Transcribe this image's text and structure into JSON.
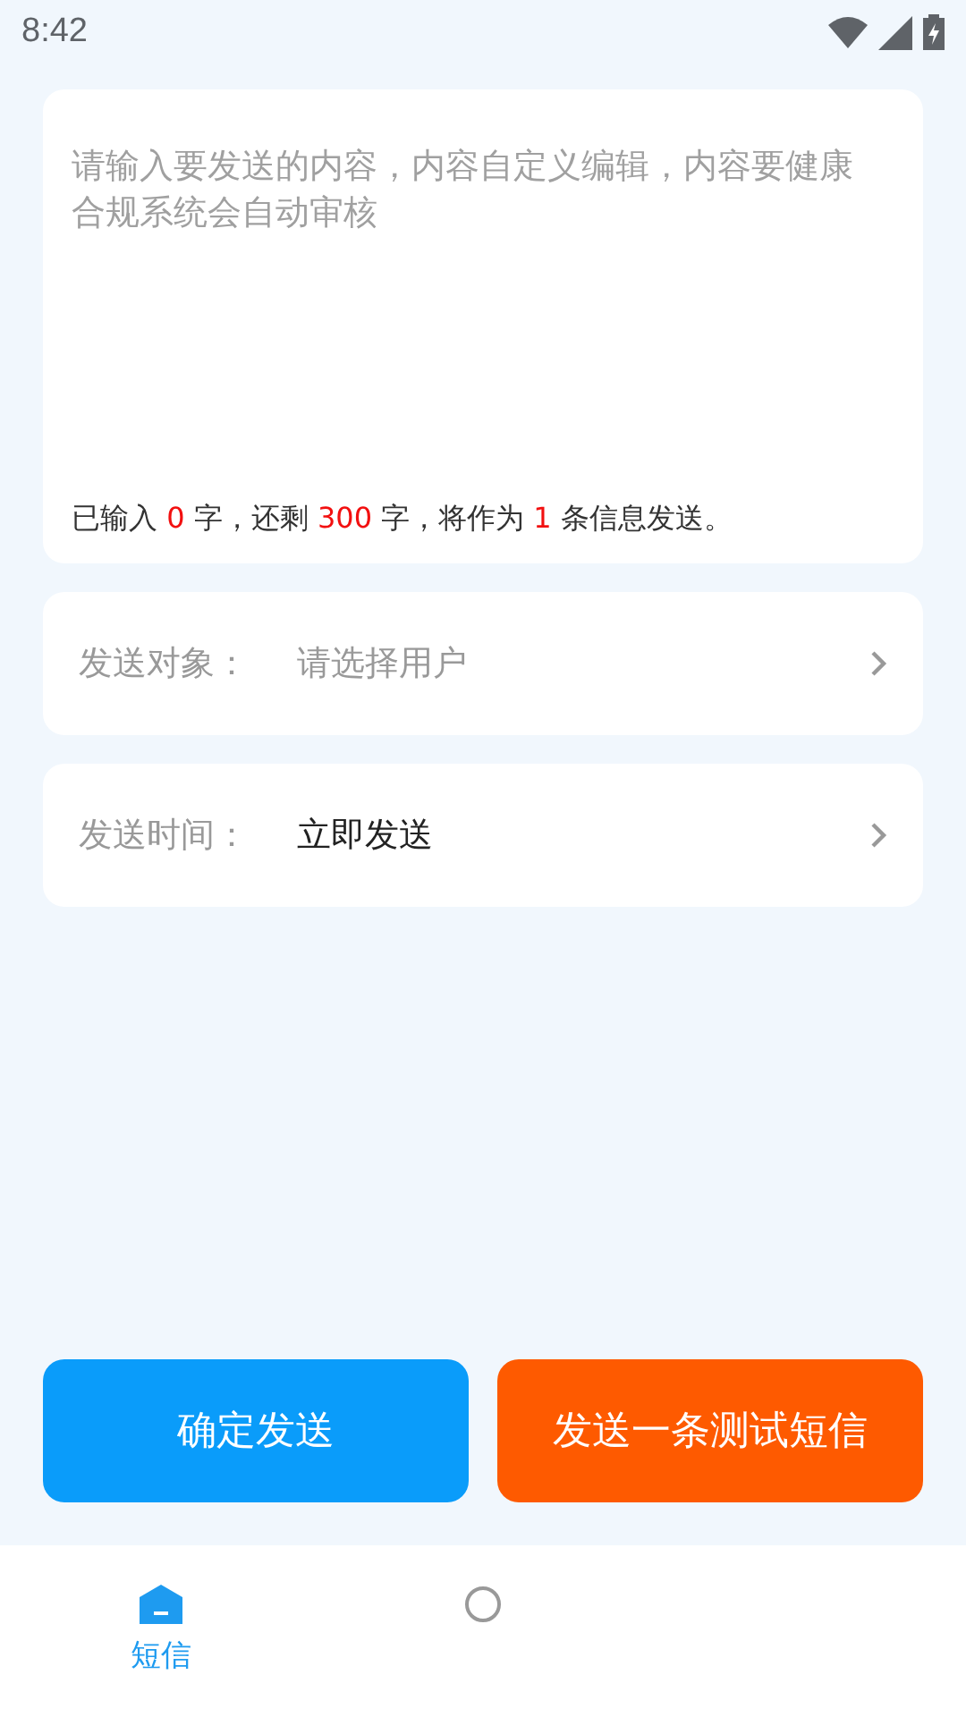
{
  "status_bar": {
    "time": "8:42"
  },
  "message": {
    "placeholder": "请输入要发送的内容，内容自定义编辑，内容要健康合规系统会自动审核",
    "counter": [
      {
        "text": "已输入 ",
        "highlight": false
      },
      {
        "text": "0",
        "highlight": true
      },
      {
        "text": " 字，还剩 ",
        "highlight": false
      },
      {
        "text": "300",
        "highlight": true
      },
      {
        "text": " 字，将作为 ",
        "highlight": false
      },
      {
        "text": "1",
        "highlight": true
      },
      {
        "text": " 条信息发送。",
        "highlight": false
      }
    ]
  },
  "fields": [
    {
      "label": "发送对象：",
      "value": "请选择用户",
      "is_placeholder": true
    },
    {
      "label": "发送时间：",
      "value": "立即发送",
      "is_placeholder": false
    }
  ],
  "buttons": [
    {
      "label": "确定发送",
      "kind": "primary"
    },
    {
      "label": "发送一条测试短信",
      "kind": "test"
    }
  ],
  "bottom_nav": [
    {
      "label": "短信",
      "selected": true,
      "kind": "home"
    },
    {
      "selected": false,
      "kind": "other"
    }
  ]
}
